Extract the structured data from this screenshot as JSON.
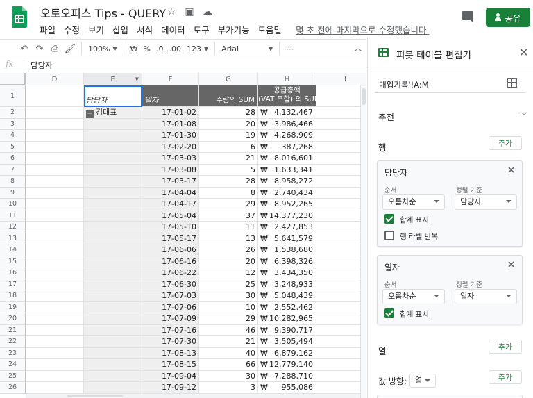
{
  "app": {
    "title": "오토오피스 Tips - QUERY",
    "menu": [
      "파일",
      "수정",
      "보기",
      "삽입",
      "서식",
      "데이터",
      "도구",
      "부가기능",
      "도움말"
    ],
    "last_edit": "몇 초 전에 마지막으로 수정했습니다.",
    "share_label": "공유"
  },
  "toolbar": {
    "zoom": "100%",
    "currency": "₩",
    "percent": "%",
    "dec_decrease": ".0",
    "dec_increase": ".00",
    "format_more": "123",
    "font": "Arial",
    "more": "⋯"
  },
  "formula_bar": {
    "fx": "fx",
    "value": "담당자"
  },
  "sheet": {
    "columns": [
      "D",
      "E",
      "F",
      "G",
      "H",
      "I"
    ],
    "row_numbers": [
      "1",
      "2",
      "3",
      "4",
      "5",
      "6",
      "7",
      "8",
      "9",
      "10",
      "11",
      "12",
      "13",
      "14",
      "15",
      "16",
      "17",
      "18",
      "19",
      "20",
      "21",
      "22",
      "23",
      "24",
      "25",
      "26"
    ],
    "header": {
      "owner": "담당자",
      "date": "일자",
      "qty_sum": "수량의 SUM",
      "supply_line1": "공급총액",
      "supply_line2": "(VAT 포함) 의 SUM"
    },
    "group_label": "김대표",
    "currency_symbol": "₩",
    "rows": [
      {
        "date": "17-01-02",
        "qty": "28",
        "amount": "4,132,467"
      },
      {
        "date": "17-01-08",
        "qty": "20",
        "amount": "3,986,466"
      },
      {
        "date": "17-01-30",
        "qty": "19",
        "amount": "4,268,909"
      },
      {
        "date": "17-02-20",
        "qty": "6",
        "amount": "387,268"
      },
      {
        "date": "17-03-03",
        "qty": "21",
        "amount": "8,016,601"
      },
      {
        "date": "17-03-08",
        "qty": "5",
        "amount": "1,633,341"
      },
      {
        "date": "17-03-17",
        "qty": "28",
        "amount": "8,958,272"
      },
      {
        "date": "17-04-04",
        "qty": "8",
        "amount": "2,740,434"
      },
      {
        "date": "17-04-17",
        "qty": "29",
        "amount": "8,952,265"
      },
      {
        "date": "17-05-04",
        "qty": "37",
        "amount": "14,377,230"
      },
      {
        "date": "17-05-10",
        "qty": "11",
        "amount": "2,427,853"
      },
      {
        "date": "17-05-17",
        "qty": "13",
        "amount": "5,641,579"
      },
      {
        "date": "17-06-06",
        "qty": "26",
        "amount": "1,538,680"
      },
      {
        "date": "17-06-16",
        "qty": "20",
        "amount": "6,398,326"
      },
      {
        "date": "17-06-22",
        "qty": "12",
        "amount": "3,434,350"
      },
      {
        "date": "17-06-30",
        "qty": "25",
        "amount": "3,248,933"
      },
      {
        "date": "17-07-03",
        "qty": "30",
        "amount": "5,048,439"
      },
      {
        "date": "17-07-06",
        "qty": "10",
        "amount": "2,552,462"
      },
      {
        "date": "17-07-09",
        "qty": "29",
        "amount": "10,282,965"
      },
      {
        "date": "17-07-16",
        "qty": "46",
        "amount": "9,390,717"
      },
      {
        "date": "17-07-30",
        "qty": "21",
        "amount": "3,505,494"
      },
      {
        "date": "17-08-13",
        "qty": "40",
        "amount": "6,879,162"
      },
      {
        "date": "17-08-15",
        "qty": "66",
        "amount": "12,779,140"
      },
      {
        "date": "17-09-04",
        "qty": "30",
        "amount": "7,288,710"
      },
      {
        "date": "17-09-12",
        "qty": "3",
        "amount": "955,086"
      }
    ]
  },
  "pivot_editor": {
    "title": "피봇 테이블 편집기",
    "range": "'매입기록'!A:M",
    "recommend_label": "추천",
    "rows_label": "행",
    "add_label": "추가",
    "columns_label": "열",
    "values_dir_label": "값 방향:",
    "values_dir_value": "열",
    "row_fields": [
      {
        "name": "담당자",
        "order_label": "순서",
        "order_value": "오름차순",
        "sort_label": "정렬 기준",
        "sort_value": "담당자",
        "show_totals": "합계 표시",
        "repeat_labels": "행 라벨 반복"
      },
      {
        "name": "일자",
        "order_label": "순서",
        "order_value": "오름차순",
        "sort_label": "정렬 기준",
        "sort_value": "일자",
        "show_totals": "합계 표시"
      }
    ]
  }
}
